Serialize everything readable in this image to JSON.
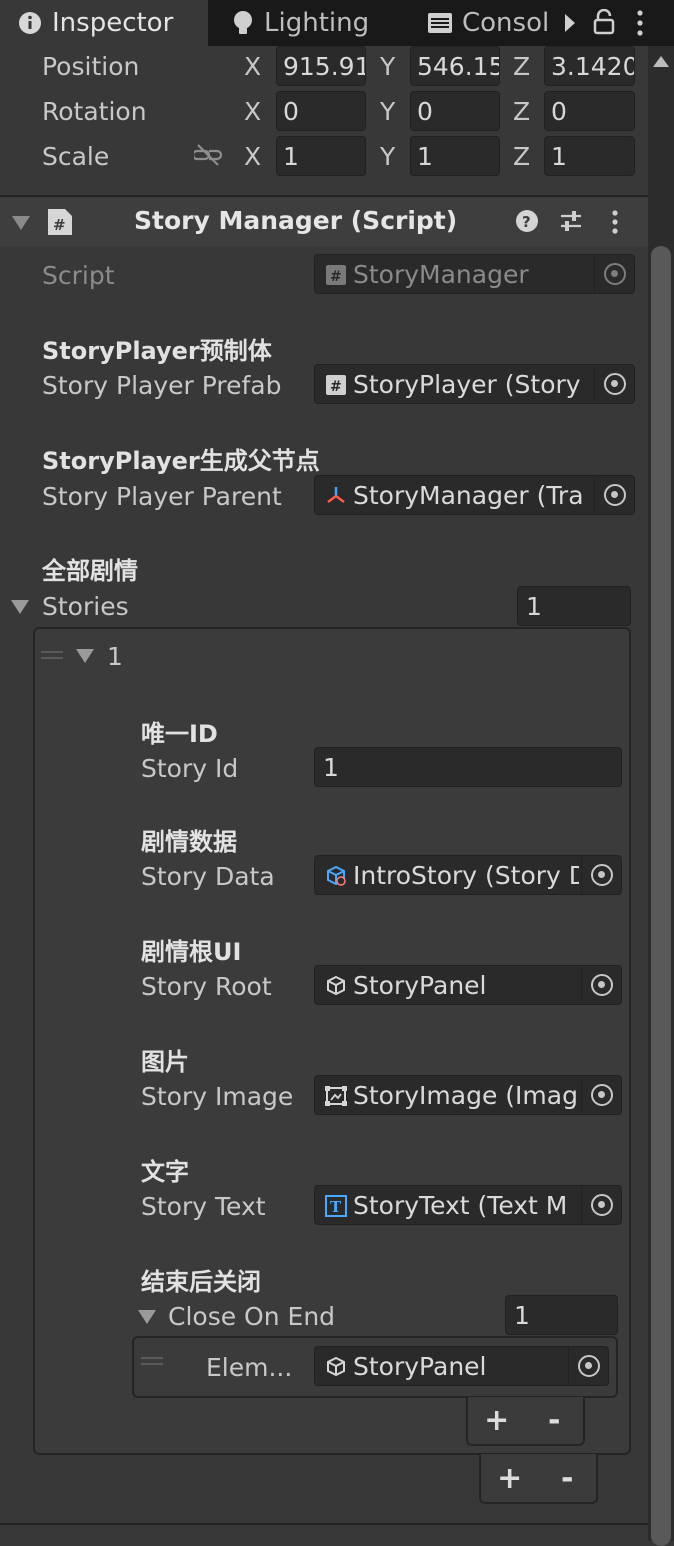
{
  "tabs": [
    {
      "label": "Inspector",
      "icon": "info-icon"
    },
    {
      "label": "Lighting",
      "icon": "lightbulb-icon"
    },
    {
      "label": "Consol",
      "icon": "console-icon"
    }
  ],
  "transform": {
    "position": {
      "label": "Position",
      "x_label": "X",
      "x": "915.91",
      "y_label": "Y",
      "y": "546.15",
      "z_label": "Z",
      "z": "3.1420"
    },
    "rotation": {
      "label": "Rotation",
      "x_label": "X",
      "x": "0",
      "y_label": "Y",
      "y": "0",
      "z_label": "Z",
      "z": "0"
    },
    "scale": {
      "label": "Scale",
      "x_label": "X",
      "x": "1",
      "y_label": "Y",
      "y": "1",
      "z_label": "Z",
      "z": "1"
    }
  },
  "component": {
    "title": "Story Manager (Script)",
    "script_label": "Script",
    "script_value": "StoryManager",
    "player_prefab_header": "StoryPlayer预制体",
    "player_prefab_label": "Story Player Prefab",
    "player_prefab_value": "StoryPlayer (Story",
    "player_parent_header": "StoryPlayer生成父节点",
    "player_parent_label": "Story Player Parent",
    "player_parent_value": "StoryManager (Tra",
    "stories_header": "全部剧情",
    "stories_label": "Stories",
    "stories_count": "1",
    "element_title": "1",
    "story_id_header": "唯一ID",
    "story_id_label": "Story Id",
    "story_id_value": "1",
    "story_data_header": "剧情数据",
    "story_data_label": "Story Data",
    "story_data_value": "IntroStory (Story D",
    "story_root_header": "剧情根UI",
    "story_root_label": "Story Root",
    "story_root_value": "StoryPanel",
    "story_image_header": "图片",
    "story_image_label": "Story Image",
    "story_image_value": "StoryImage (Imag",
    "story_text_header": "文字",
    "story_text_label": "Story Text",
    "story_text_value": "StoryText (Text M",
    "close_header": "结束后关闭",
    "close_label": "Close On End",
    "close_count": "1",
    "close_elem_label": "Elem...",
    "close_elem_value": "StoryPanel",
    "plus": "+",
    "minus": "-"
  },
  "colors": {
    "background": "#383838",
    "field": "#2a2a2a",
    "tabbar": "#191919"
  }
}
